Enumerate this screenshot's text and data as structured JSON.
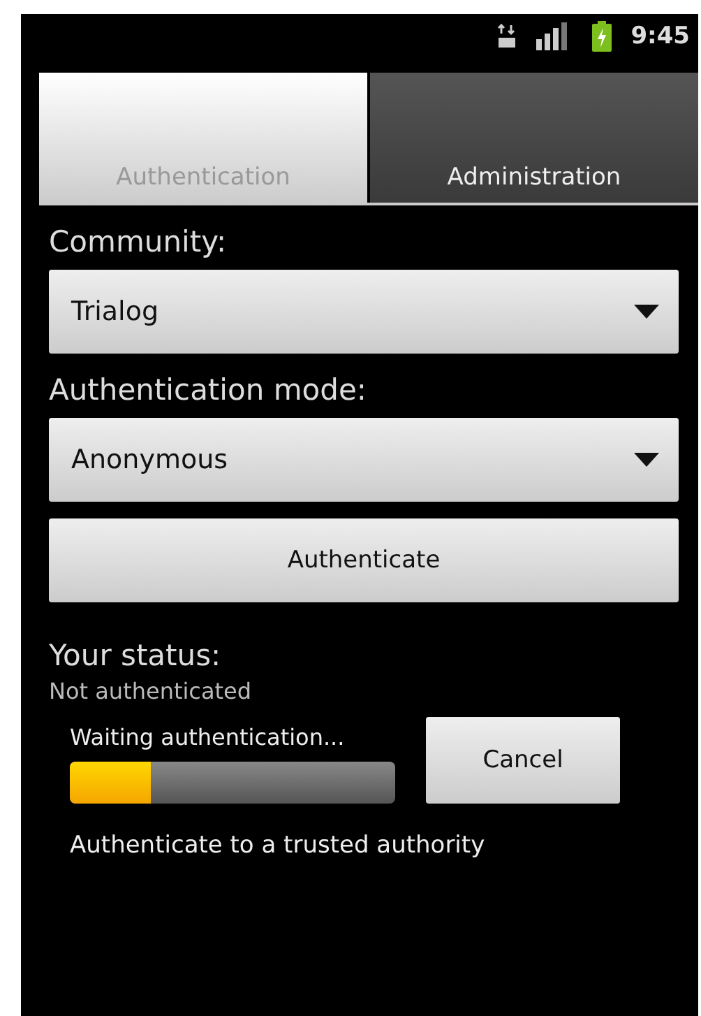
{
  "status_bar": {
    "time": "9:45"
  },
  "tabs": [
    {
      "label": "Authentication",
      "selected": true
    },
    {
      "label": "Administration",
      "selected": false
    }
  ],
  "community": {
    "label": "Community:",
    "value": "Trialog"
  },
  "auth_mode": {
    "label": "Authentication mode:",
    "value": "Anonymous"
  },
  "authenticate_button": "Authenticate",
  "status": {
    "label": "Your status:",
    "value": "Not authenticated"
  },
  "progress": {
    "label": "Waiting authentication...",
    "level": 0.25,
    "cancel": "Cancel"
  },
  "footer": "Authenticate to a trusted authority"
}
